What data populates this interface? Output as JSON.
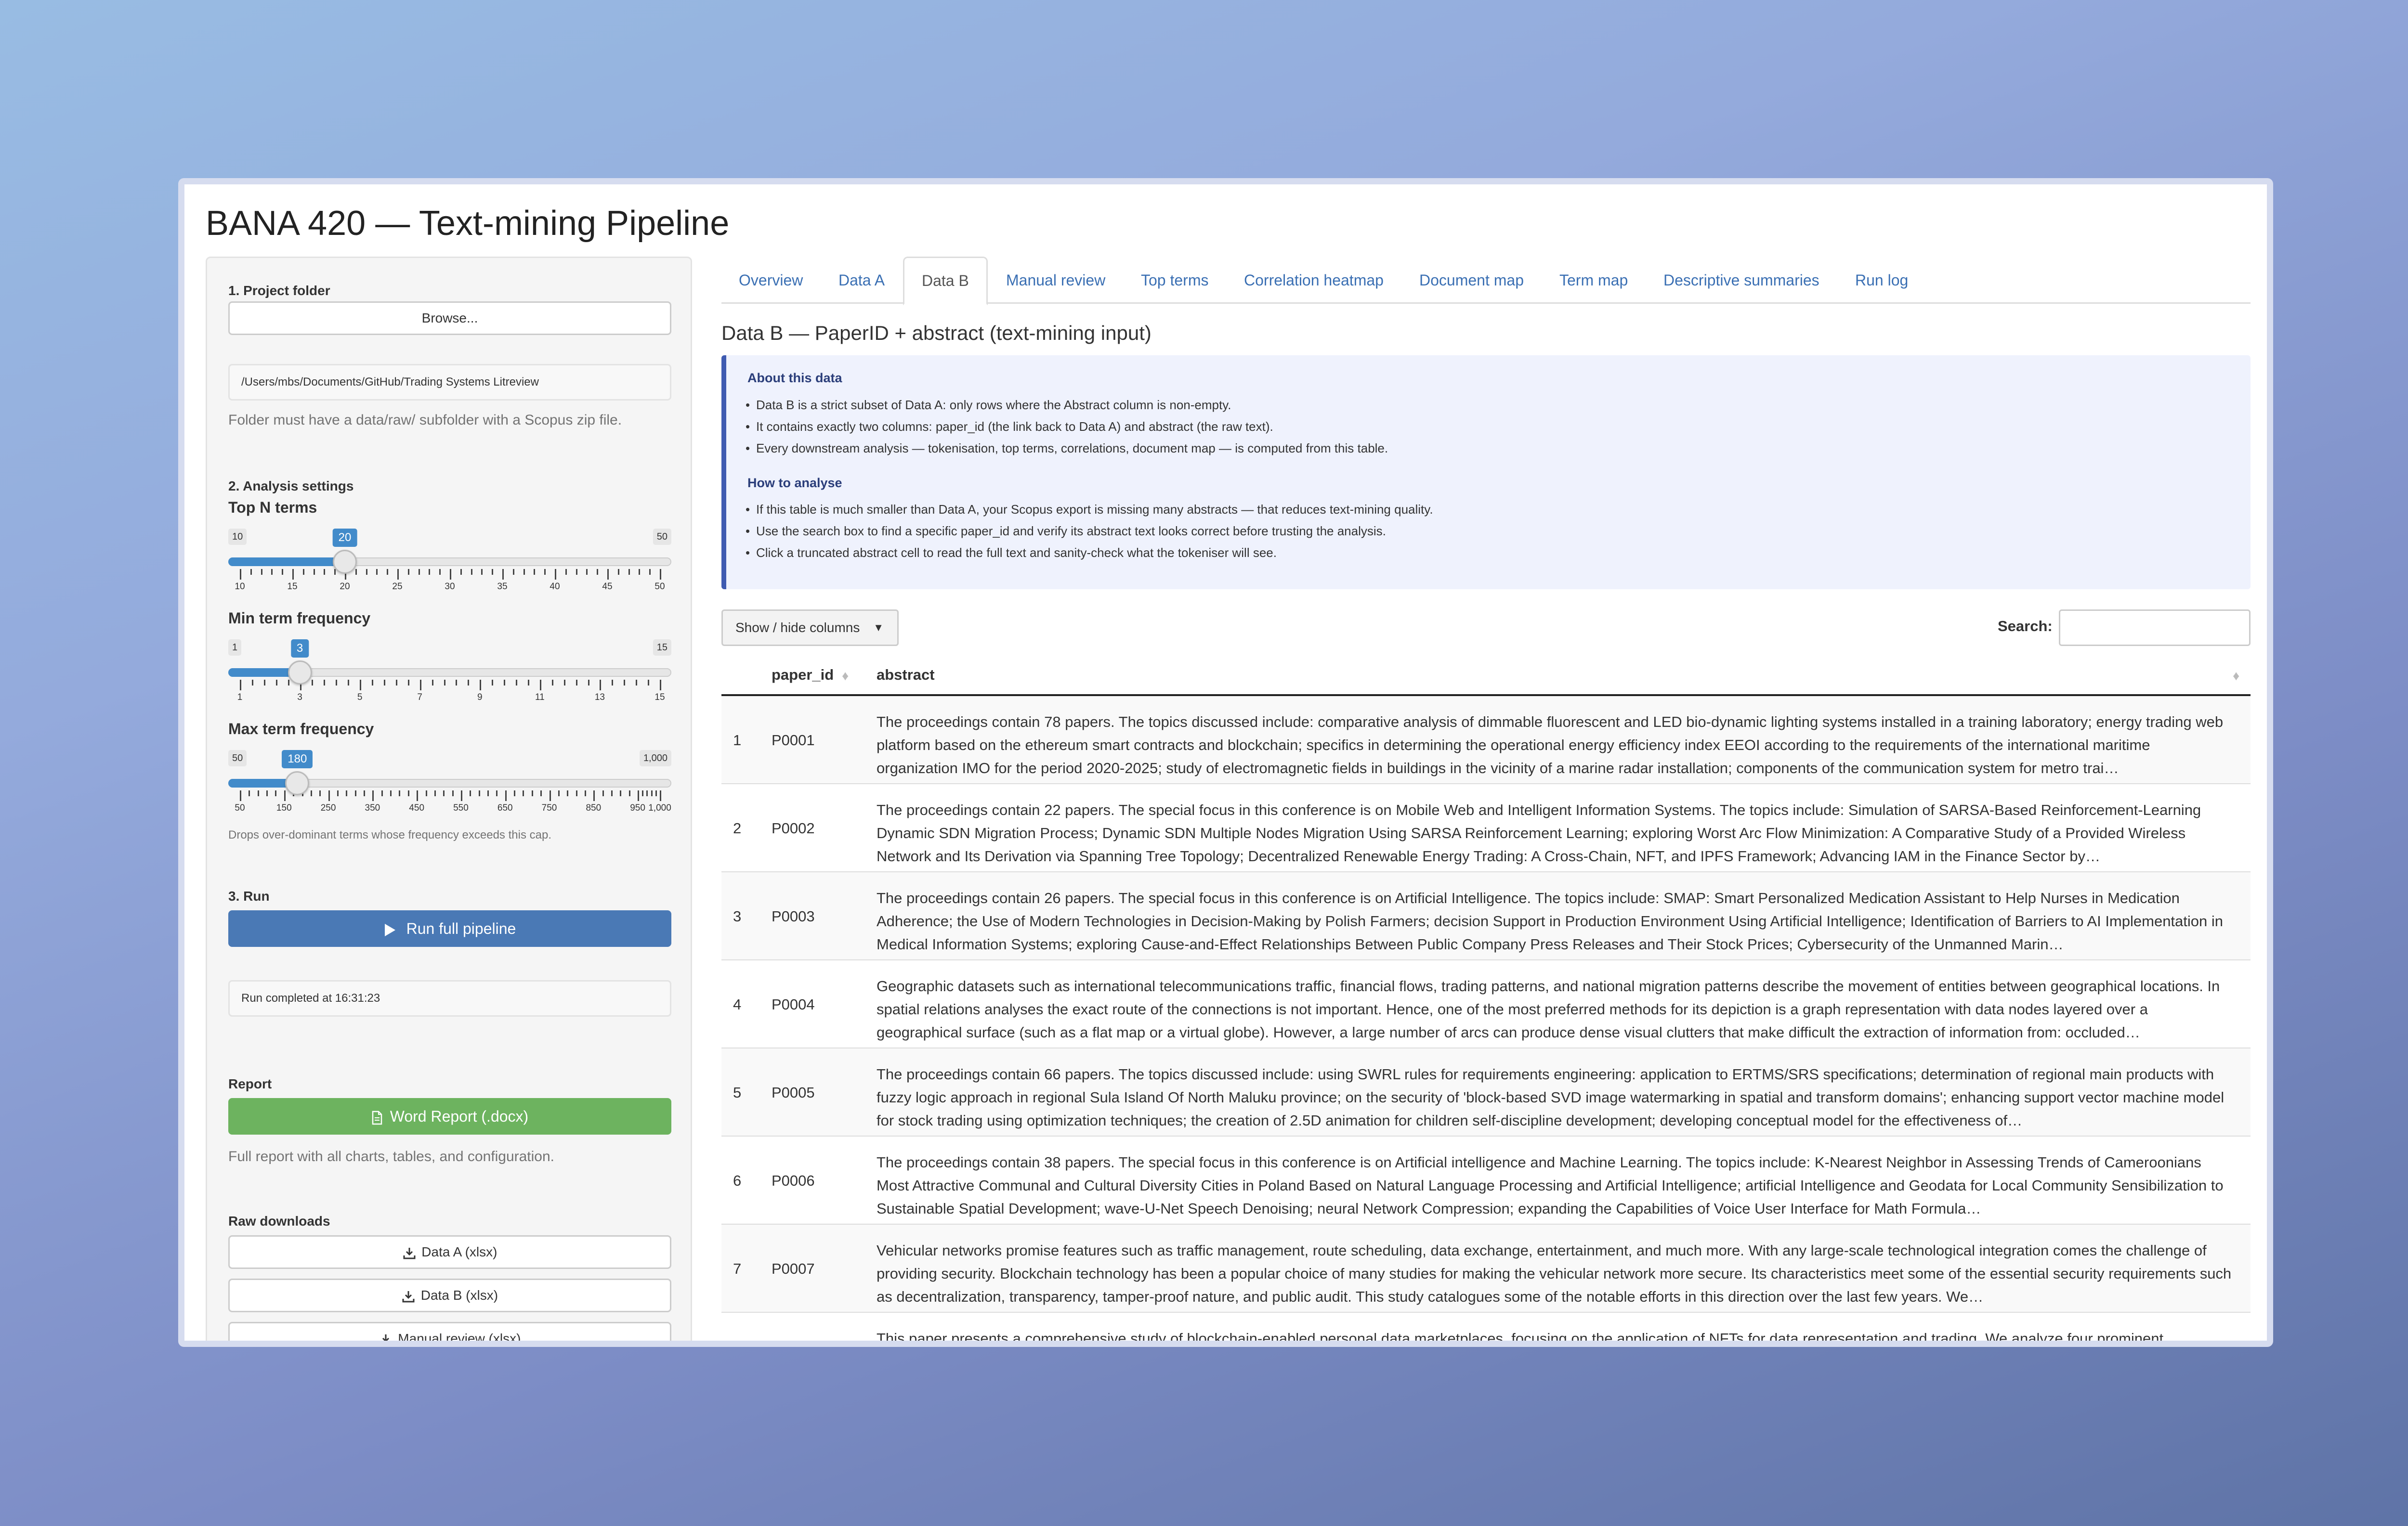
{
  "app": {
    "title": "BANA 420 — Text-mining Pipeline"
  },
  "sidebar": {
    "project": {
      "label": "1. Project folder",
      "browse_label": "Browse...",
      "path": "/Users/mbs/Documents/GitHub/Trading Systems Litreview",
      "help": "Folder must have a data/raw/ subfolder with a Scopus zip file."
    },
    "analysis": {
      "label": "2. Analysis settings",
      "top_n": {
        "label": "Top N terms",
        "min": 10,
        "max": 50,
        "value": 20,
        "min_label": "10",
        "max_label": "50",
        "value_label": "20",
        "ticks": [
          "10",
          "15",
          "20",
          "25",
          "30",
          "35",
          "40",
          "45",
          "50"
        ]
      },
      "min_freq": {
        "label": "Min term frequency",
        "min": 1,
        "max": 15,
        "value": 3,
        "min_label": "1",
        "max_label": "15",
        "value_label": "3",
        "ticks": [
          "1",
          "3",
          "5",
          "7",
          "9",
          "11",
          "13",
          "15"
        ]
      },
      "max_freq": {
        "label": "Max term frequency",
        "min": 50,
        "max": 1000,
        "value": 180,
        "min_label": "50",
        "max_label": "1,000",
        "value_label": "180",
        "ticks": [
          "50",
          "150",
          "250",
          "350",
          "450",
          "550",
          "650",
          "750",
          "850",
          "950",
          "1,000"
        ]
      },
      "max_help": "Drops over-dominant terms whose frequency exceeds this cap."
    },
    "run": {
      "label": "3. Run",
      "button_label": "Run full pipeline",
      "status": "Run completed at 16:31:23"
    },
    "report": {
      "label": "Report",
      "button_label": "Word Report (.docx)",
      "help": "Full report with all charts, tables, and configuration."
    },
    "raw": {
      "label": "Raw downloads",
      "buttons": [
        "Data A (xlsx)",
        "Data B (xlsx)",
        "Manual review (xlsx)"
      ]
    }
  },
  "tabs": [
    "Overview",
    "Data A",
    "Data B",
    "Manual review",
    "Top terms",
    "Correlation heatmap",
    "Document map",
    "Term map",
    "Descriptive summaries",
    "Run log"
  ],
  "active_tab": "Data B",
  "main": {
    "title": "Data B — PaperID + abstract (text-mining input)",
    "about_heading": "About this data",
    "about_items": [
      "Data B is a strict subset of Data A: only rows where the Abstract column is non-empty.",
      "It contains exactly two columns: paper_id (the link back to Data A) and abstract (the raw text).",
      "Every downstream analysis — tokenisation, top terms, correlations, document map — is computed from this table."
    ],
    "howto_heading": "How to analyse",
    "howto_items": [
      "If this table is much smaller than Data A, your Scopus export is missing many abstracts — that reduces text-mining quality.",
      "Use the search box to find a specific paper_id and verify its abstract text looks correct before trusting the analysis.",
      "Click a truncated abstract cell to read the full text and sanity-check what the tokeniser will see."
    ],
    "colvis_label": "Show / hide columns",
    "search_label": "Search:",
    "table": {
      "columns": [
        "paper_id",
        "abstract"
      ],
      "rows": [
        {
          "n": "1",
          "id": "P0001",
          "abstract": "The proceedings contain 78 papers. The topics discussed include: comparative analysis of dimmable fluorescent and LED bio-dynamic lighting systems installed in a training laboratory; energy trading web platform based on the ethereum smart contracts and blockchain; specifics in determining the operational energy efficiency index EEOI according to the requirements of the international maritime organization IMO for the period 2020-2025; study of electromagnetic fields in buildings in the vicinity of a marine radar installation; components of the communication system for metro trai…"
        },
        {
          "n": "2",
          "id": "P0002",
          "abstract": "The proceedings contain 22 papers. The special focus in this conference is on Mobile Web and Intelligent Information Systems. The topics include: Simulation of SARSA-Based Reinforcement-Learning Dynamic SDN Migration Process; Dynamic SDN Multiple Nodes Migration Using SARSA Reinforcement Learning; exploring Worst Arc Flow Minimization: A Comparative Study of a Provided Wireless Network and Its Derivation via Spanning Tree Topology; Decentralized Renewable Energy Trading: A Cross-Chain, NFT, and IPFS Framework; Advancing IAM in the Finance Sector by…"
        },
        {
          "n": "3",
          "id": "P0003",
          "abstract": "The proceedings contain 26 papers. The special focus in this conference is on Artificial Intelligence. The topics include: SMAP: Smart Personalized Medication Assistant to Help Nurses in Medication Adherence; the Use of Modern Technologies in Decision-Making by Polish Farmers; decision Support in Production Environment Using Artificial Intelligence; Identification of Barriers to AI Implementation in Medical Information Systems; exploring Cause-and-Effect Relationships Between Public Company Press Releases and Their Stock Prices; Cybersecurity of the Unmanned Marin…"
        },
        {
          "n": "4",
          "id": "P0004",
          "abstract": "Geographic datasets such as international telecommunications traffic, financial flows, trading patterns, and national migration patterns describe the movement of entities between geographical locations. In spatial relations analyses the exact route of the connections is not important. Hence, one of the most preferred methods for its depiction is a graph representation with data nodes layered over a geographical surface (such as a flat map or a virtual globe). However, a large number of arcs can produce dense visual clutters that make difficult the extraction of information from: occluded…"
        },
        {
          "n": "5",
          "id": "P0005",
          "abstract": "The proceedings contain 66 papers. The topics discussed include: using SWRL rules for requirements engineering: application to ERTMS/SRS specifications; determination of regional main products with fuzzy logic approach in regional Sula Island Of North Maluku province; on the security of 'block-based SVD image watermarking in spatial and transform domains'; enhancing support vector machine model for stock trading using optimization techniques; the creation of 2.5D animation for children self-discipline development; developing conceptual model for the effectiveness of…"
        },
        {
          "n": "6",
          "id": "P0006",
          "abstract": "The proceedings contain 38 papers. The special focus in this conference is on Artificial intelligence and Machine Learning. The topics include: K-Nearest Neighbor in Assessing Trends of Cameroonians Most Attractive Communal and Cultural Diversity Cities in Poland Based on Natural Language Processing and Artificial Intelligence; artificial Intelligence and Geodata for Local Community Sensibilization to Sustainable Spatial Development; wave-U-Net Speech Denoising; neural Network Compression; expanding the Capabilities of Voice User Interface for Math Formula…"
        },
        {
          "n": "7",
          "id": "P0007",
          "abstract": "Vehicular networks promise features such as traffic management, route scheduling, data exchange, entertainment, and much more. With any large-scale technological integration comes the challenge of providing security. Blockchain technology has been a popular choice of many studies for making the vehicular network more secure. Its characteristics meet some of the essential security requirements such as decentralization, transparency, tamper-proof nature, and public audit. This study catalogues some of the notable efforts in this direction over the last few years. We…"
        },
        {
          "n": "",
          "id": "",
          "abstract": "This paper presents a comprehensive study of blockchain-enabled personal data marketplaces, focusing on the application of NFTs for data representation and trading. We analyze four prominent"
        }
      ]
    }
  }
}
